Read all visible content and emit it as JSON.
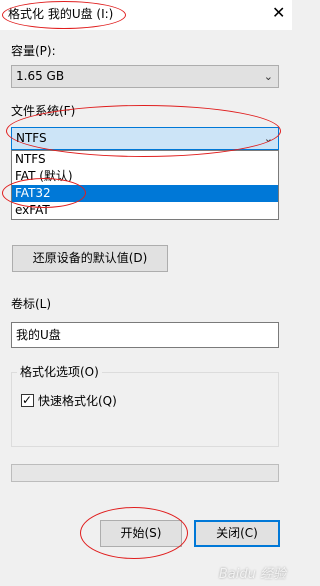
{
  "window": {
    "title": "格式化 我的U盘 (I:)",
    "close_glyph": "✕"
  },
  "capacity": {
    "label": "容量(P):",
    "value": "1.65 GB"
  },
  "file_system": {
    "label": "文件系统(F)",
    "value": "NTFS",
    "options": [
      "NTFS",
      "FAT (默认)",
      "FAT32",
      "exFAT"
    ],
    "highlighted_option": "FAT32"
  },
  "restore_button": "还原设备的默认值(D)",
  "volume_label": {
    "label": "卷标(L)",
    "value": "我的U盘"
  },
  "format_options": {
    "title": "格式化选项(O)",
    "quick_format_label": "快速格式化(Q)",
    "quick_format_checked": true
  },
  "progress": {
    "value": 0
  },
  "buttons": {
    "start": "开始(S)",
    "close": "关闭(C)"
  },
  "colors": {
    "accent": "#0078d7",
    "annotation": "#e01e1e",
    "window_bg": "#f0f0f0"
  },
  "icons": {
    "close": "close-icon",
    "dropdown_arrow": "chevron-down-icon",
    "check": "checkmark-icon"
  },
  "watermark": "Baidu 经验"
}
